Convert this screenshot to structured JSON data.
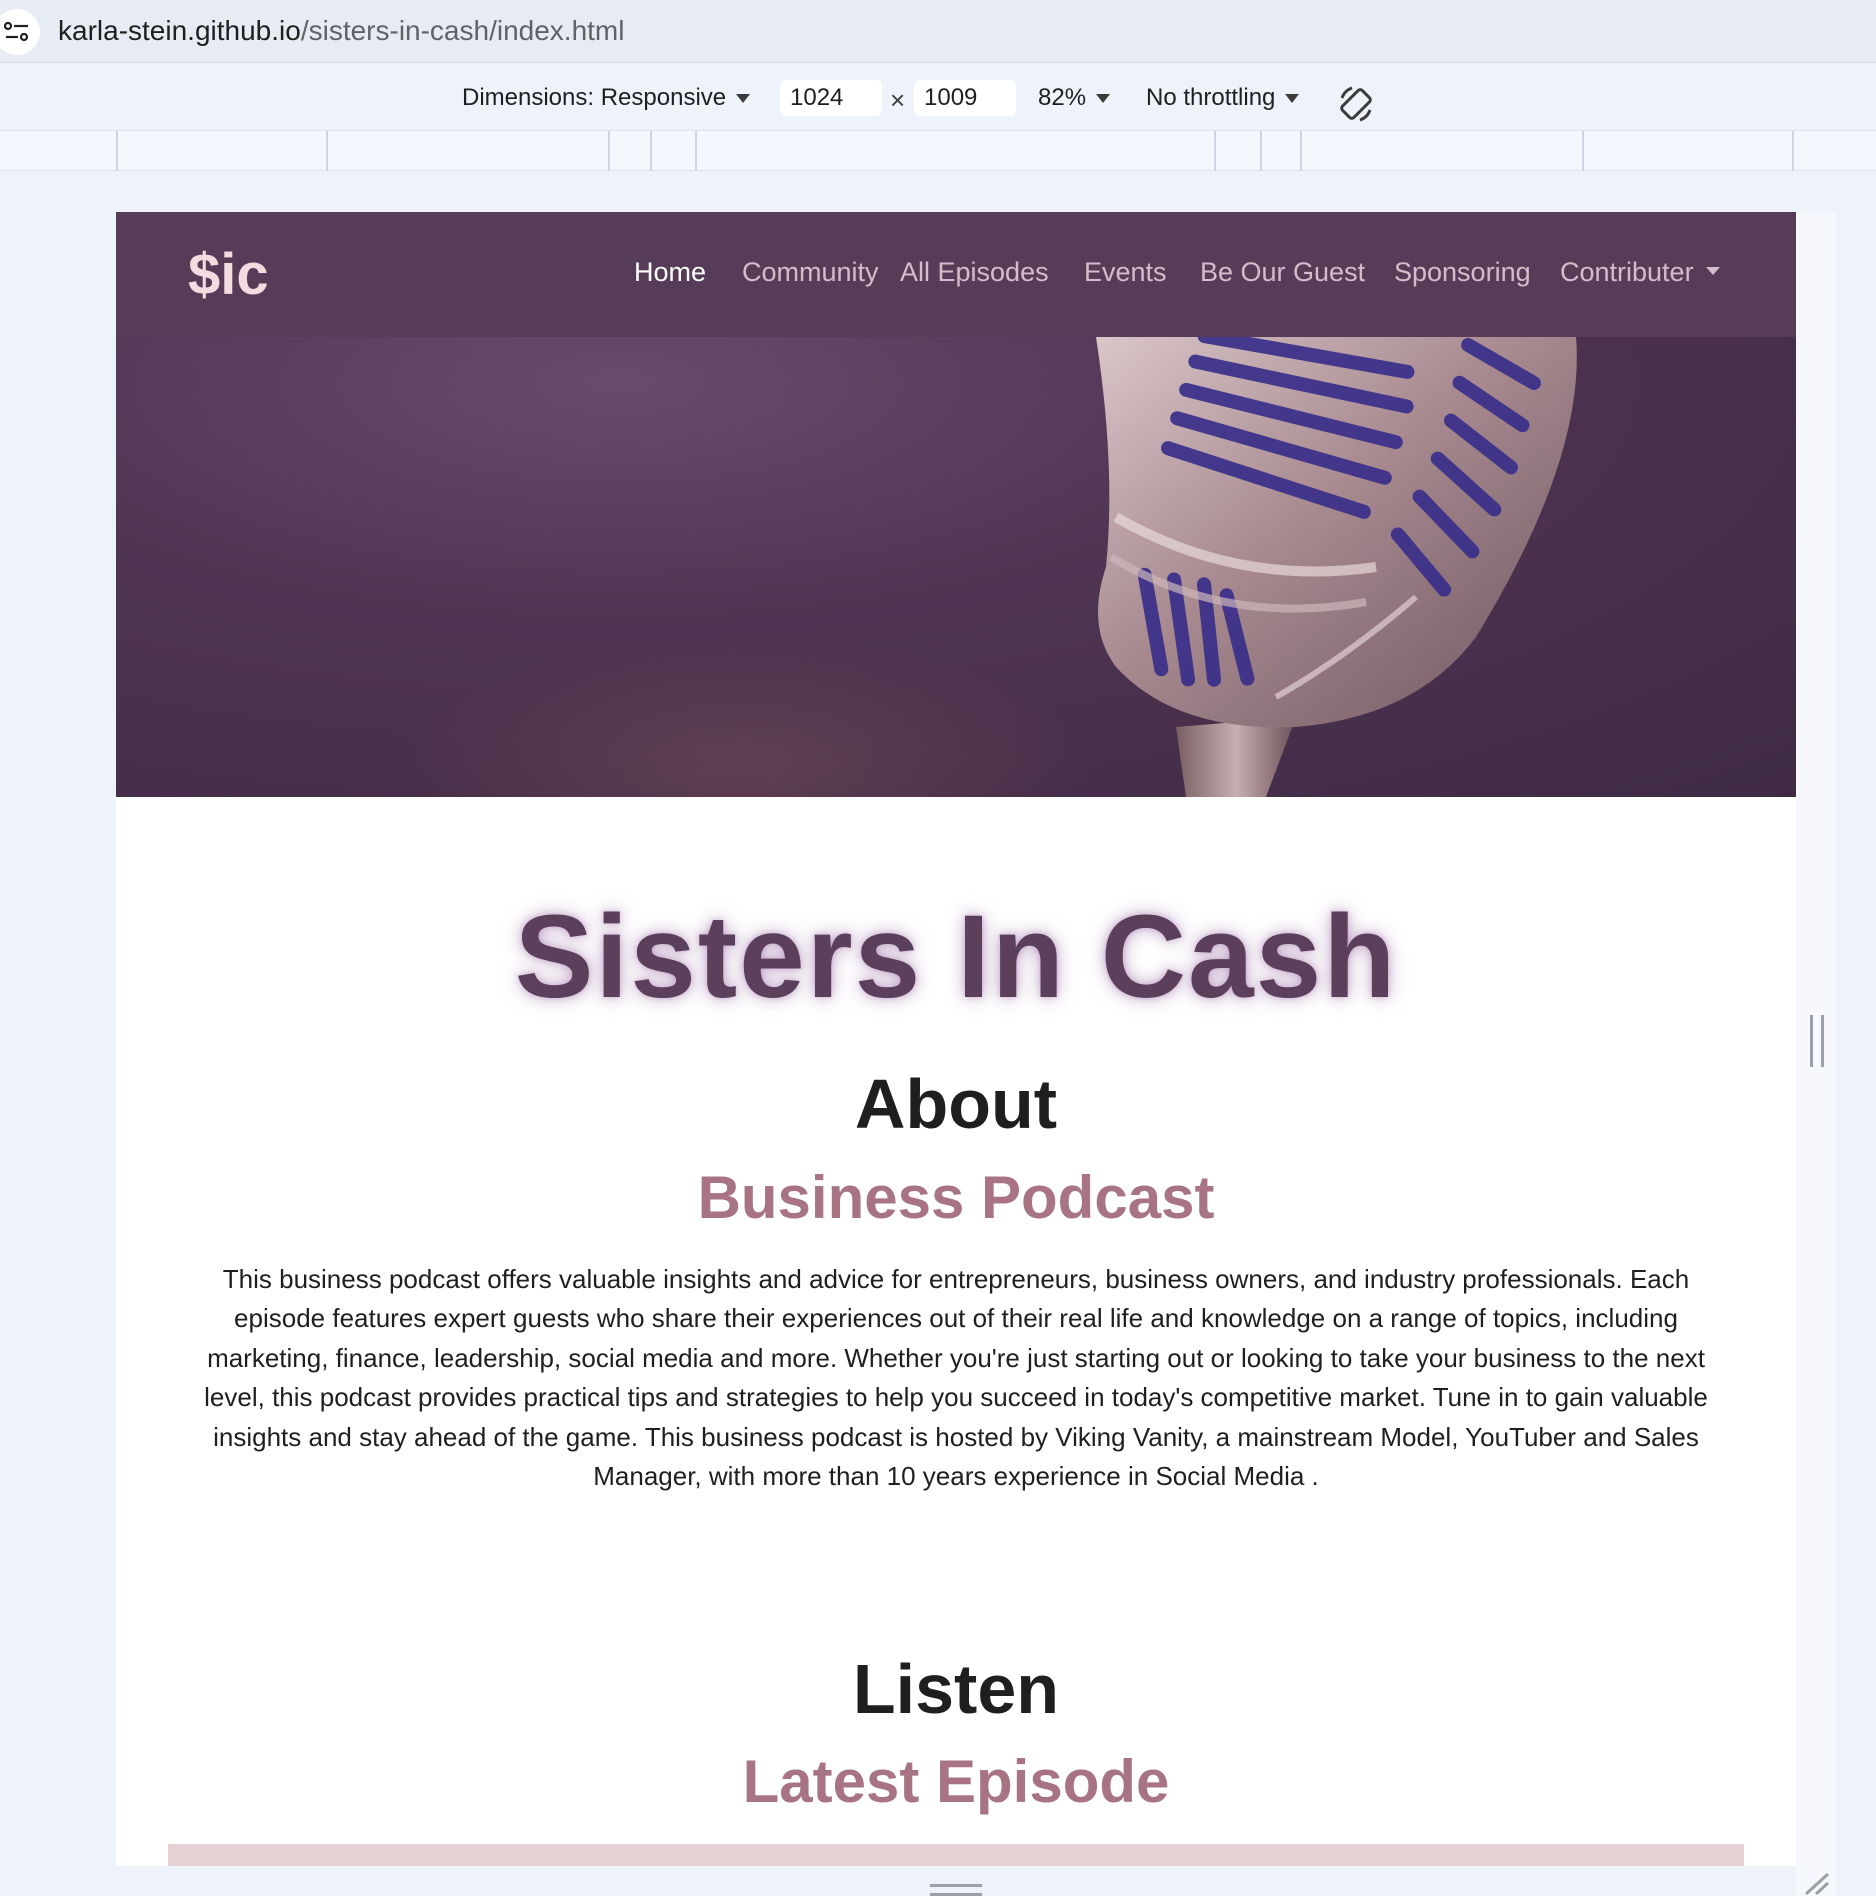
{
  "browser": {
    "url_host": "karla-stein.github.io",
    "url_path": "/sisters-in-cash/index.html"
  },
  "devtools": {
    "dimensions_label": "Dimensions: Responsive",
    "width_value": "1024",
    "times": "×",
    "height_value": "1009",
    "zoom": "82%",
    "throttling": "No throttling"
  },
  "navbar": {
    "brand": "$ic",
    "links": [
      {
        "label": "Home",
        "active": true
      },
      {
        "label": "Community"
      },
      {
        "label": "All Episodes"
      },
      {
        "label": "Events"
      },
      {
        "label": "Be Our Guest"
      },
      {
        "label": "Sponsoring"
      },
      {
        "label": "Contributer"
      }
    ]
  },
  "main": {
    "title": "Sisters In Cash",
    "about_heading": "About",
    "about_subheading": "Business Podcast",
    "about_text": "This business podcast offers valuable insights and advice for entrepreneurs, business owners, and industry professionals. Each episode features expert guests who share their experiences out of their real life and knowledge on a range of topics, including marketing, finance, leadership, social media and more. Whether you're just starting out or looking to take your business to the next level, this podcast provides practical tips and strategies to help you succeed in today's competitive market. Tune in to gain valuable insights and stay ahead of the game. This business podcast is hosted by Viking Vanity, a mainstream Model, YouTuber and Sales Manager, with more than 10 years experience in Social Media .",
    "listen_heading": "Listen",
    "listen_subheading": "Latest Episode"
  },
  "colors": {
    "navbar_bg": "#573c58",
    "brand": "#f1dce0",
    "title": "#5b3f5b",
    "subheading": "#a87484",
    "player_bar": "#e6d2d4"
  },
  "icons": [
    "site-info-icon",
    "dropdown-caret-icon",
    "rotate-device-icon",
    "microphone-image",
    "resize-handle-icon"
  ]
}
